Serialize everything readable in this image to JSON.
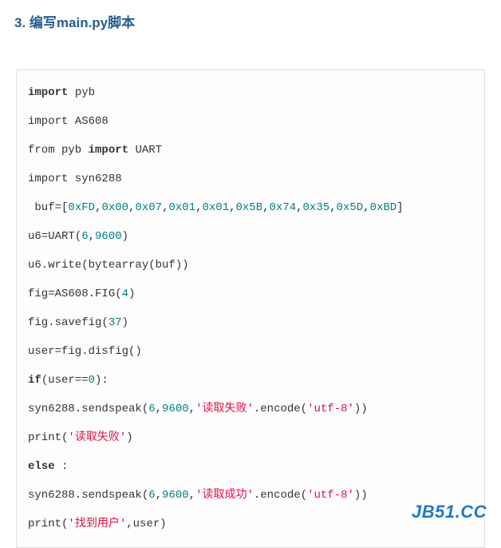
{
  "heading": "3. 编写main.py脚本",
  "watermark": "JB51.CC",
  "code": {
    "lines": [
      {
        "tokens": [
          {
            "t": "kw",
            "v": "import"
          },
          {
            "t": "p",
            "v": " pyb"
          }
        ]
      },
      {
        "tokens": [
          {
            "t": "p",
            "v": "import AS608"
          }
        ]
      },
      {
        "tokens": [
          {
            "t": "p",
            "v": "from pyb "
          },
          {
            "t": "kw",
            "v": "import"
          },
          {
            "t": "p",
            "v": " UART"
          }
        ]
      },
      {
        "tokens": [
          {
            "t": "p",
            "v": "import syn6288"
          }
        ]
      },
      {
        "tokens": [
          {
            "t": "p",
            "v": " buf=["
          },
          {
            "t": "num",
            "v": "0xFD"
          },
          {
            "t": "p",
            "v": ","
          },
          {
            "t": "num",
            "v": "0x00"
          },
          {
            "t": "p",
            "v": ","
          },
          {
            "t": "num",
            "v": "0x07"
          },
          {
            "t": "p",
            "v": ","
          },
          {
            "t": "num",
            "v": "0x01"
          },
          {
            "t": "p",
            "v": ","
          },
          {
            "t": "num",
            "v": "0x01"
          },
          {
            "t": "p",
            "v": ","
          },
          {
            "t": "num",
            "v": "0x5B"
          },
          {
            "t": "p",
            "v": ","
          },
          {
            "t": "num",
            "v": "0x74"
          },
          {
            "t": "p",
            "v": ","
          },
          {
            "t": "num",
            "v": "0x35"
          },
          {
            "t": "p",
            "v": ","
          },
          {
            "t": "num",
            "v": "0x5D"
          },
          {
            "t": "p",
            "v": ","
          },
          {
            "t": "num",
            "v": "0xBD"
          },
          {
            "t": "p",
            "v": "]"
          }
        ]
      },
      {
        "tokens": [
          {
            "t": "p",
            "v": "u6=UART("
          },
          {
            "t": "num",
            "v": "6"
          },
          {
            "t": "p",
            "v": ","
          },
          {
            "t": "num",
            "v": "9600"
          },
          {
            "t": "p",
            "v": ")"
          }
        ]
      },
      {
        "tokens": [
          {
            "t": "p",
            "v": "u6.write(bytearray(buf))"
          }
        ]
      },
      {
        "tokens": [
          {
            "t": "p",
            "v": "fig=AS608.FIG("
          },
          {
            "t": "num",
            "v": "4"
          },
          {
            "t": "p",
            "v": ")"
          }
        ]
      },
      {
        "tokens": [
          {
            "t": "p",
            "v": "fig.savefig("
          },
          {
            "t": "num",
            "v": "37"
          },
          {
            "t": "p",
            "v": ")"
          }
        ]
      },
      {
        "tokens": [
          {
            "t": "p",
            "v": "user=fig.disfig()"
          }
        ]
      },
      {
        "tokens": [
          {
            "t": "kw",
            "v": "if"
          },
          {
            "t": "p",
            "v": "(user=="
          },
          {
            "t": "num",
            "v": "0"
          },
          {
            "t": "p",
            "v": "):"
          }
        ]
      },
      {
        "tokens": [
          {
            "t": "p",
            "v": "syn6288.sendspeak("
          },
          {
            "t": "num",
            "v": "6"
          },
          {
            "t": "p",
            "v": ","
          },
          {
            "t": "num",
            "v": "9600"
          },
          {
            "t": "p",
            "v": ","
          },
          {
            "t": "str",
            "v": "'读取失败'"
          },
          {
            "t": "p",
            "v": ".encode("
          },
          {
            "t": "str",
            "v": "'utf-8'"
          },
          {
            "t": "p",
            "v": "))"
          }
        ]
      },
      {
        "tokens": [
          {
            "t": "p",
            "v": "print("
          },
          {
            "t": "str",
            "v": "'读取失败'"
          },
          {
            "t": "p",
            "v": ")"
          }
        ]
      },
      {
        "tokens": [
          {
            "t": "kw",
            "v": "else"
          },
          {
            "t": "p",
            "v": " :"
          }
        ]
      },
      {
        "tokens": [
          {
            "t": "p",
            "v": "syn6288.sendspeak("
          },
          {
            "t": "num",
            "v": "6"
          },
          {
            "t": "p",
            "v": ","
          },
          {
            "t": "num",
            "v": "9600"
          },
          {
            "t": "p",
            "v": ","
          },
          {
            "t": "str",
            "v": "'读取成功'"
          },
          {
            "t": "p",
            "v": ".encode("
          },
          {
            "t": "str",
            "v": "'utf-8'"
          },
          {
            "t": "p",
            "v": "))"
          }
        ]
      },
      {
        "tokens": [
          {
            "t": "p",
            "v": "print("
          },
          {
            "t": "str",
            "v": "'找到用户'"
          },
          {
            "t": "p",
            "v": ",user)"
          }
        ]
      }
    ]
  }
}
